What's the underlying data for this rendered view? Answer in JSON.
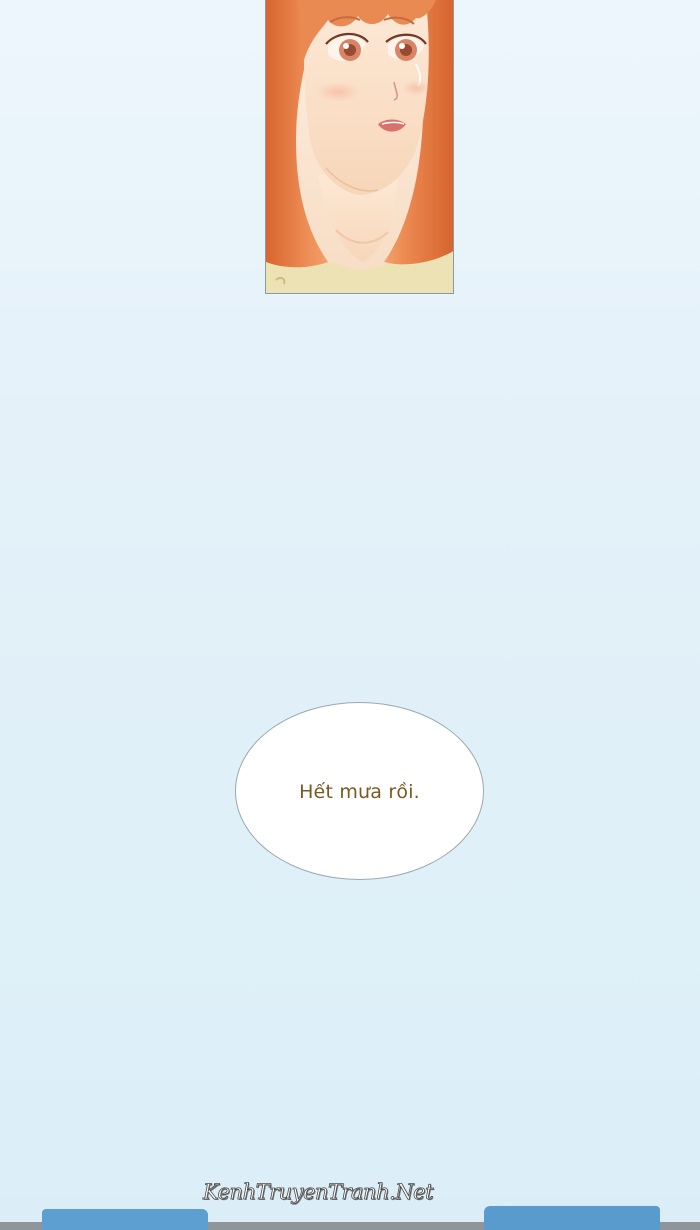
{
  "bubble": {
    "text": "Hết mưa rồi."
  },
  "watermark": {
    "text": "KenhTruyenTranh.Net"
  },
  "panel": {
    "subject": "girl-with-orange-hair-crying"
  },
  "colors": {
    "background": "#e3f1f9",
    "bubble_text": "#7a5a22",
    "hair": "#e98a52",
    "skin": "#fbe4cf"
  }
}
